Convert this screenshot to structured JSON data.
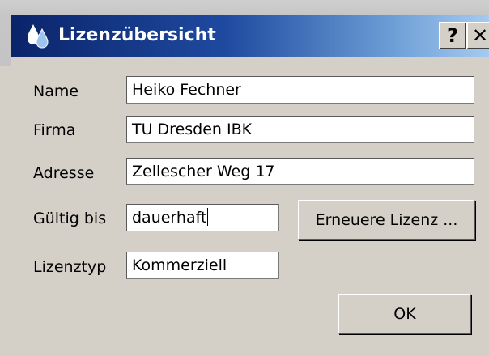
{
  "window": {
    "title": "Lizenzübersicht",
    "icon": "droplets-icon",
    "help_label": "?",
    "close_label": "✕"
  },
  "form": {
    "name_label": "Name",
    "name_value": "Heiko Fechner",
    "company_label": "Firma",
    "company_value": "TU Dresden IBK",
    "address_label": "Adresse",
    "address_value": "Zellescher Weg 17",
    "valid_until_label": "Gültig bis",
    "valid_until_value": "dauerhaft",
    "license_type_label": "Lizenztyp",
    "license_type_value": "Kommerziell"
  },
  "buttons": {
    "renew_label": "Erneuere Lizenz ...",
    "ok_label": "OK"
  },
  "colors": {
    "title_gradient_start": "#0a246a",
    "title_gradient_end": "#a6caf0",
    "dialog_face": "#d4d0c8",
    "title_text": "#ffffff"
  }
}
